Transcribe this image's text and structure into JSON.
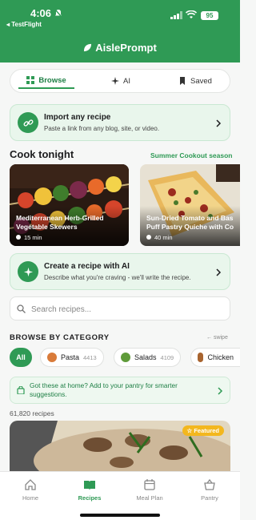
{
  "status": {
    "time": "4:06",
    "back_label": "◂ TestFlight",
    "battery": "95"
  },
  "app": {
    "title": "AislePrompt"
  },
  "segments": [
    {
      "label": "Browse",
      "icon": "grid-icon"
    },
    {
      "label": "AI",
      "icon": "sparkle-icon"
    },
    {
      "label": "Saved",
      "icon": "bookmark-icon"
    }
  ],
  "import_card": {
    "title": "Import any recipe",
    "subtitle": "Paste a link from any blog, site, or video.",
    "icon": "link-icon"
  },
  "cook_tonight": {
    "heading": "Cook tonight",
    "link": "Summer Cookout season",
    "recipes": [
      {
        "title_line1": "Mediterranean Herb-Grilled",
        "title_line2": "Vegetable Skewers",
        "time": "15 min"
      },
      {
        "title_line1": "Sun-Dried Tomato and Bas",
        "title_line2": "Puff Pastry Quiche with Co",
        "time": "40 min"
      }
    ]
  },
  "ai_card": {
    "title": "Create a recipe with AI",
    "subtitle": "Describe what you're craving - we'll write the recipe.",
    "icon": "sparkle-icon"
  },
  "search": {
    "placeholder": "Search recipes..."
  },
  "categories": {
    "heading": "BROWSE BY CATEGORY",
    "swipe_hint": "← swipe",
    "chips": [
      {
        "label": "All"
      },
      {
        "label": "Pasta",
        "count": "4413"
      },
      {
        "label": "Salads",
        "count": "4109"
      },
      {
        "label": "Chicken",
        "count": ""
      }
    ]
  },
  "pantry_card": {
    "text": "Got these at home? Add to your pantry for smarter suggestions."
  },
  "recipe_count": "61,820 recipes",
  "featured": {
    "badge": "☆ Featured"
  },
  "tabs": [
    {
      "label": "Home",
      "icon": "home-icon"
    },
    {
      "label": "Recipes",
      "icon": "book-icon"
    },
    {
      "label": "Meal Plan",
      "icon": "calendar-icon"
    },
    {
      "label": "Pantry",
      "icon": "basket-icon"
    }
  ],
  "colors": {
    "brand": "#2f9a55",
    "accent_bg": "#e9f6ec",
    "featured_badge": "#f3b71e"
  }
}
